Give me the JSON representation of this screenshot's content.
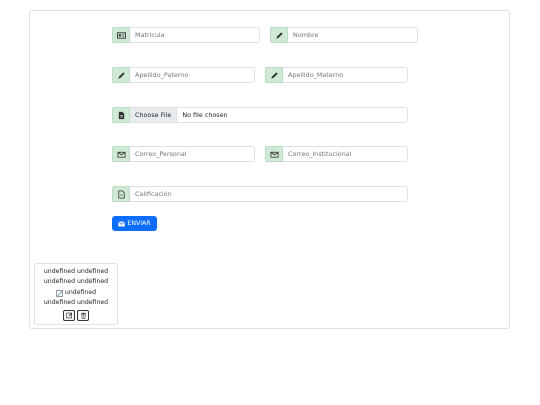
{
  "form": {
    "matricula": {
      "placeholder": "Matricula",
      "icon": "id-card-icon"
    },
    "nombre": {
      "placeholder": "Nombre",
      "icon": "pencil-icon"
    },
    "apellido_paterno": {
      "placeholder": "Apellido_Paterno",
      "icon": "pencil-icon"
    },
    "apellido_materno": {
      "placeholder": "Apellido_Materno",
      "icon": "pencil-icon"
    },
    "file": {
      "button_label": "Choose File",
      "status": "No file chosen",
      "icon": "file-icon"
    },
    "correo_personal": {
      "placeholder": "Correo_Personal",
      "icon": "envelope-icon"
    },
    "correo_institucional": {
      "placeholder": "Correo_Institucional",
      "icon": "envelope-icon"
    },
    "calificacion": {
      "placeholder": "Calificación",
      "icon": "document-icon"
    },
    "submit_label": "ENVIAR"
  },
  "record": {
    "line1": "undefined undefined",
    "line2": "undefined undefined",
    "image_alt": "undefined",
    "line3": "undefined undefined"
  },
  "colors": {
    "addon_bg": "#cfe9d6",
    "primary": "#0d6efd",
    "border": "#dee2e6"
  }
}
